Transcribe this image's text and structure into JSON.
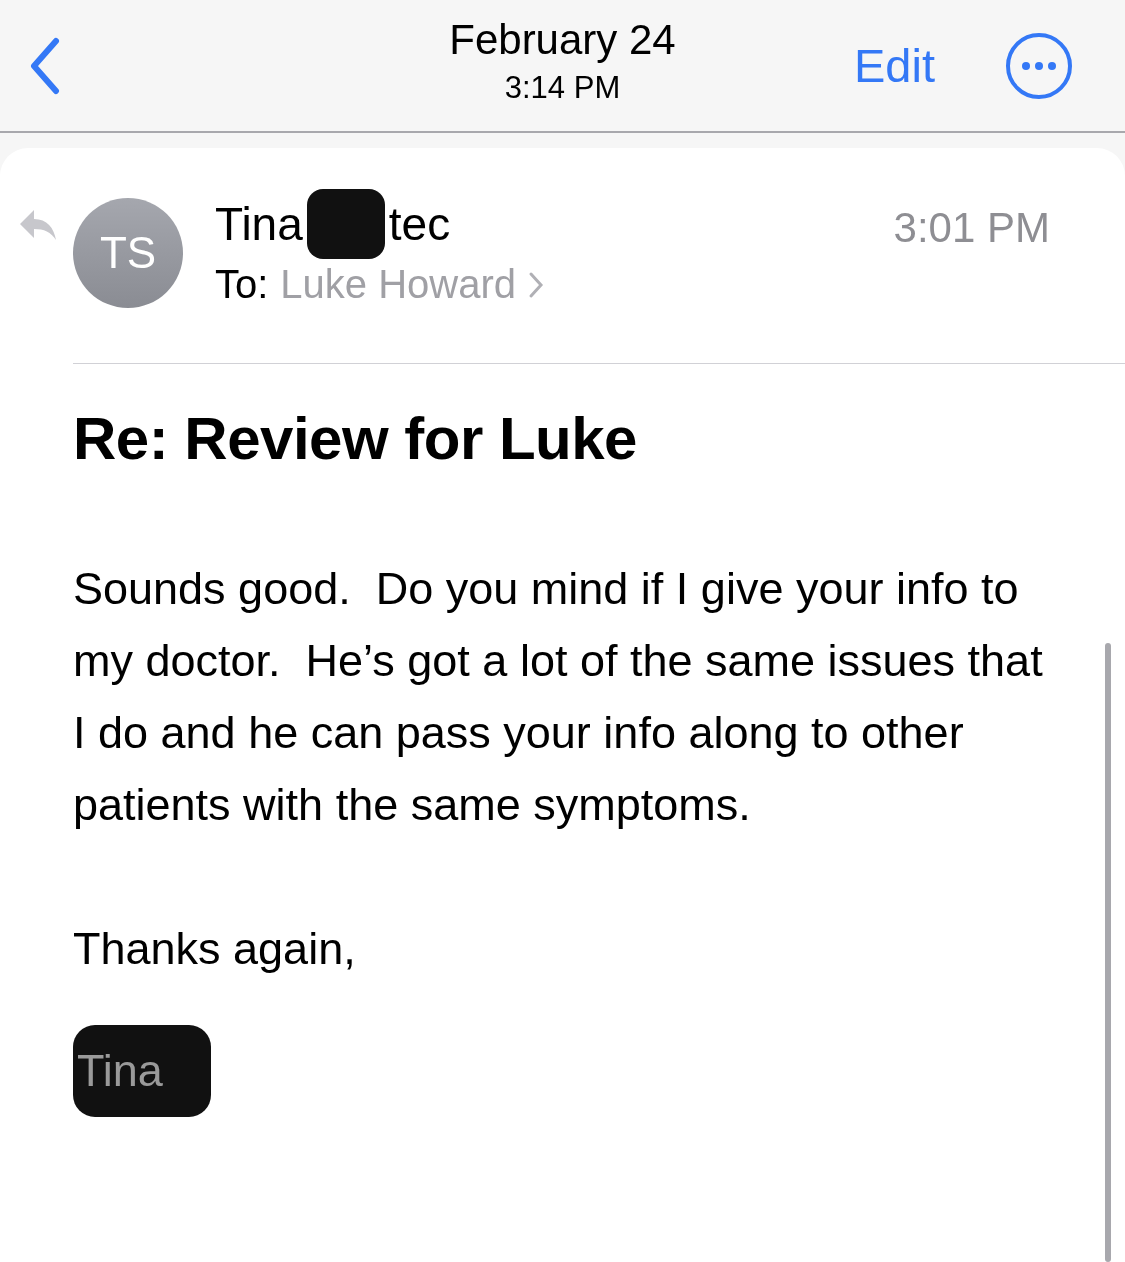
{
  "header": {
    "date": "February 24",
    "time": "3:14 PM",
    "edit": "Edit"
  },
  "message": {
    "avatar": "TS",
    "sender_visible_start": "Tina",
    "sender_visible_end": "tec",
    "sender_redacted": true,
    "to_label": "To:",
    "recipient": "Luke Howard",
    "time": "3:01 PM",
    "subject": "Re: Review for Luke",
    "paragraphs": [
      "Sounds good.  Do you mind if I give your info to my doctor.  He’s got a lot of the same issues that I do and he can pass your info along to other patients with the same symptoms.",
      "Thanks again,"
    ],
    "signature": "Tina",
    "signature_redacted": true
  }
}
